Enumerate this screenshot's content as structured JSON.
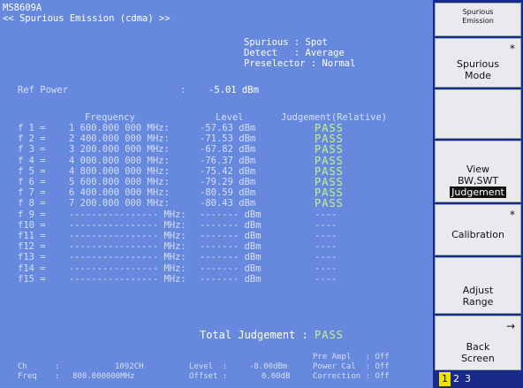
{
  "header": {
    "model": "MS8609A",
    "title": "<< Spurious Emission (cdma) >>"
  },
  "settings": {
    "spurious": "Spurious : Spot",
    "detect": "Detect   : Average",
    "preselector": "Preselector : Normal"
  },
  "ref_power": {
    "label": "Ref Power",
    "colon": ":",
    "value": "-5.01 dBm"
  },
  "table": {
    "headers": {
      "frequency": "Frequency",
      "level": "Level",
      "judgement": "Judgement(Relative)"
    },
    "rows": [
      {
        "label": "f 1 =",
        "freq": "1 600.000 000 MHz:",
        "level": "-57.63 dBm",
        "judgement": "PASS"
      },
      {
        "label": "f 2 =",
        "freq": "2 400.000 000 MHz:",
        "level": "-71.53 dBm",
        "judgement": "PASS"
      },
      {
        "label": "f 3 =",
        "freq": "3 200.000 000 MHz:",
        "level": "-67.82 dBm",
        "judgement": "PASS"
      },
      {
        "label": "f 4 =",
        "freq": "4 000.000 000 MHz:",
        "level": "-76.37 dBm",
        "judgement": "PASS"
      },
      {
        "label": "f 5 =",
        "freq": "4 800.000 000 MHz:",
        "level": "-75.42 dBm",
        "judgement": "PASS"
      },
      {
        "label": "f 6 =",
        "freq": "5 600.000 000 MHz:",
        "level": "-79.29 dBm",
        "judgement": "PASS"
      },
      {
        "label": "f 7 =",
        "freq": "6 400.000 000 MHz:",
        "level": "-80.59 dBm",
        "judgement": "PASS"
      },
      {
        "label": "f 8 =",
        "freq": "7 200.000 000 MHz:",
        "level": "-80.43 dBm",
        "judgement": "PASS"
      },
      {
        "label": "f 9 =",
        "freq": "---------------- MHz:",
        "level": "------- dBm",
        "judgement": "----"
      },
      {
        "label": "f10 =",
        "freq": "---------------- MHz:",
        "level": "------- dBm",
        "judgement": "----"
      },
      {
        "label": "f11 =",
        "freq": "---------------- MHz:",
        "level": "------- dBm",
        "judgement": "----"
      },
      {
        "label": "f12 =",
        "freq": "---------------- MHz:",
        "level": "------- dBm",
        "judgement": "----"
      },
      {
        "label": "f13 =",
        "freq": "---------------- MHz:",
        "level": "------- dBm",
        "judgement": "----"
      },
      {
        "label": "f14 =",
        "freq": "---------------- MHz:",
        "level": "------- dBm",
        "judgement": "----"
      },
      {
        "label": "f15 =",
        "freq": "---------------- MHz:",
        "level": "------- dBm",
        "judgement": "----"
      }
    ]
  },
  "total": {
    "label": "Total Judgement :",
    "value": "PASS"
  },
  "status": {
    "ch_label": "Ch",
    "ch_colon": ":",
    "ch_value": "1092CH",
    "freq_label": "Freq",
    "freq_colon": ":",
    "freq_value": "800.000000MHz",
    "level_label": "Level  :",
    "level_value": "-8.00dBm",
    "offset_label": "Offset :",
    "offset_value": "0.00dB",
    "pre_ampl": "Pre Ampl   : Off",
    "power_cal": "Power Cal  : Off",
    "correction": "Correction : Off"
  },
  "softkeys": {
    "title_line1": "Spurious",
    "title_line2": "Emission",
    "k1_mark": "*",
    "k1_line1": "Spurious",
    "k1_line2": "Mode",
    "k2_line1": "View",
    "k2_line2": "BW,SWT",
    "k2_line3": "Judgement",
    "k3_mark": "*",
    "k3_line1": "Calibration",
    "k4_line1": "Adjust",
    "k4_line2": "Range",
    "k5_mark": "→",
    "k5_line1": "Back",
    "k5_line2": "Screen"
  },
  "pages": [
    "1",
    "2",
    "3"
  ]
}
